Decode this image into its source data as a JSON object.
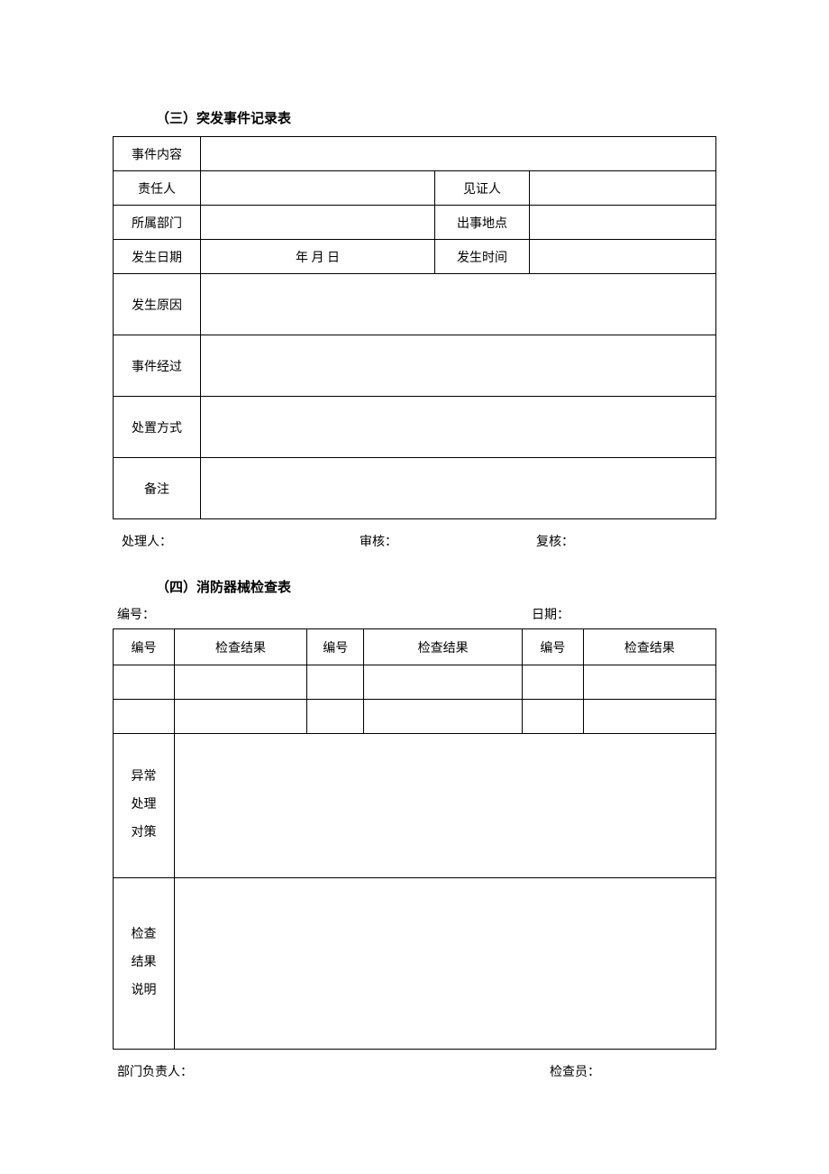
{
  "section3": {
    "title": "（三）突发事件记录表",
    "rows": {
      "content": "事件内容",
      "responsible": "责任人",
      "witness": "见证人",
      "department": "所属部门",
      "location": "出事地点",
      "date": "发生日期",
      "date_value": "年  月  日",
      "time": "发生时间",
      "cause": "发生原因",
      "process": "事件经过",
      "disposal": "处置方式",
      "remark": "备注"
    },
    "footer": {
      "handler": "处理人：",
      "audit": "审核：",
      "review": "复核："
    }
  },
  "section4": {
    "title": "（四）消防器械检查表",
    "header": {
      "number": "编号：",
      "date": "日期："
    },
    "columns": {
      "num": "编号",
      "result": "检查结果"
    },
    "labels": {
      "abnormal": "异常\n处理\n对策",
      "check_desc": "检查\n结果\n说明"
    },
    "footer": {
      "dept_head": "部门负责人：",
      "inspector": "检查员："
    }
  }
}
